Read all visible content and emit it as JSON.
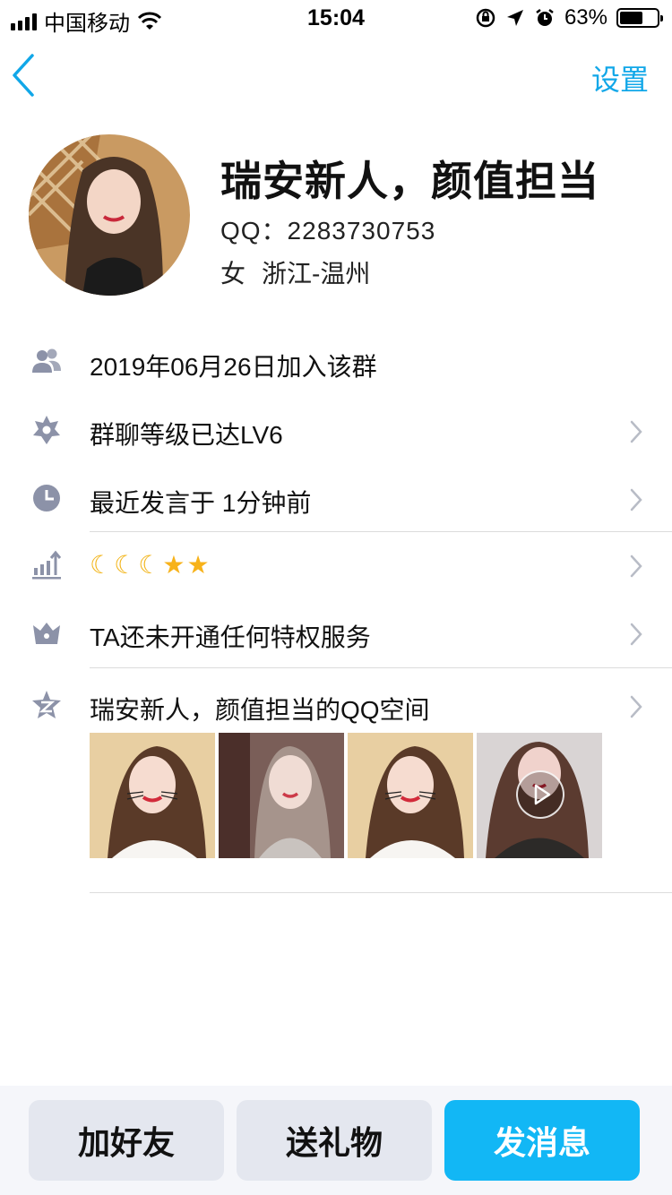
{
  "status_bar": {
    "carrier": "中国移动",
    "time": "15:04",
    "battery_text": "63%",
    "battery_level": 0.63
  },
  "nav": {
    "settings_label": "设置"
  },
  "profile": {
    "name": "瑞安新人，颜值担当",
    "qq": "QQ：2283730753",
    "gender": "女",
    "location": "浙江-温州"
  },
  "rows": {
    "joined": "2019年06月26日加入该群",
    "level": "群聊等级已达LV6",
    "last_spoke": "最近发言于 1分钟前",
    "privilege": "TA还未开通任何特权服务",
    "qzone": "瑞安新人，颜值担当的QQ空间"
  },
  "badges": {
    "moons": [
      "☾",
      "☾",
      "☾"
    ],
    "stars": [
      "★",
      "★"
    ]
  },
  "actions": {
    "add_friend": "加好友",
    "send_gift": "送礼物",
    "send_message": "发消息"
  },
  "colors": {
    "accent": "#12b7f5",
    "link": "#11a7e8",
    "icon_gray": "#8c92a8"
  },
  "icons": [
    "back-icon",
    "group-icon",
    "level-icon",
    "clock-icon",
    "rank-icon",
    "crown-icon",
    "qzone-icon",
    "chevron-right-icon",
    "play-icon"
  ]
}
